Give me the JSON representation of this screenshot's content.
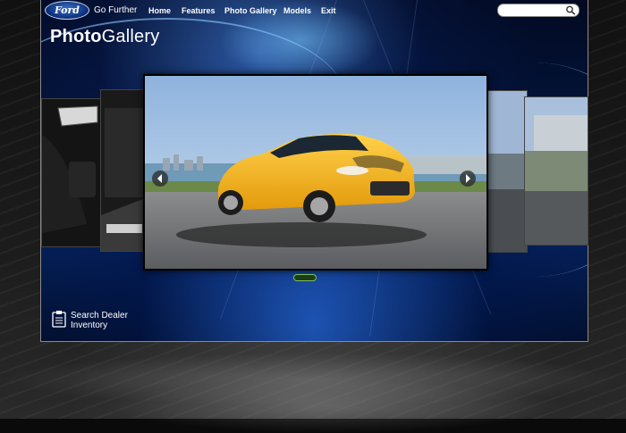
{
  "brand": {
    "logo": "Ford",
    "tagline": "Go Further"
  },
  "nav": {
    "items": [
      {
        "label": "Home"
      },
      {
        "label": "Features"
      },
      {
        "label": "Photo Gallery"
      },
      {
        "label": "Models"
      },
      {
        "label": "Exit"
      }
    ]
  },
  "search": {
    "placeholder": "",
    "icon": "search-icon"
  },
  "page": {
    "title_bold": "Photo",
    "title_light": "Gallery"
  },
  "gallery": {
    "prev_icon": "chevron-left-icon",
    "next_icon": "chevron-right-icon",
    "slide_count": 1,
    "active_slide": 1,
    "main_car_color": "#f2b21a"
  },
  "dealer": {
    "label": "Search Dealer Inventory",
    "icon": "clipboard-icon"
  },
  "colors": {
    "accent": "#1e5adc",
    "indicator": "#7ac25a"
  }
}
